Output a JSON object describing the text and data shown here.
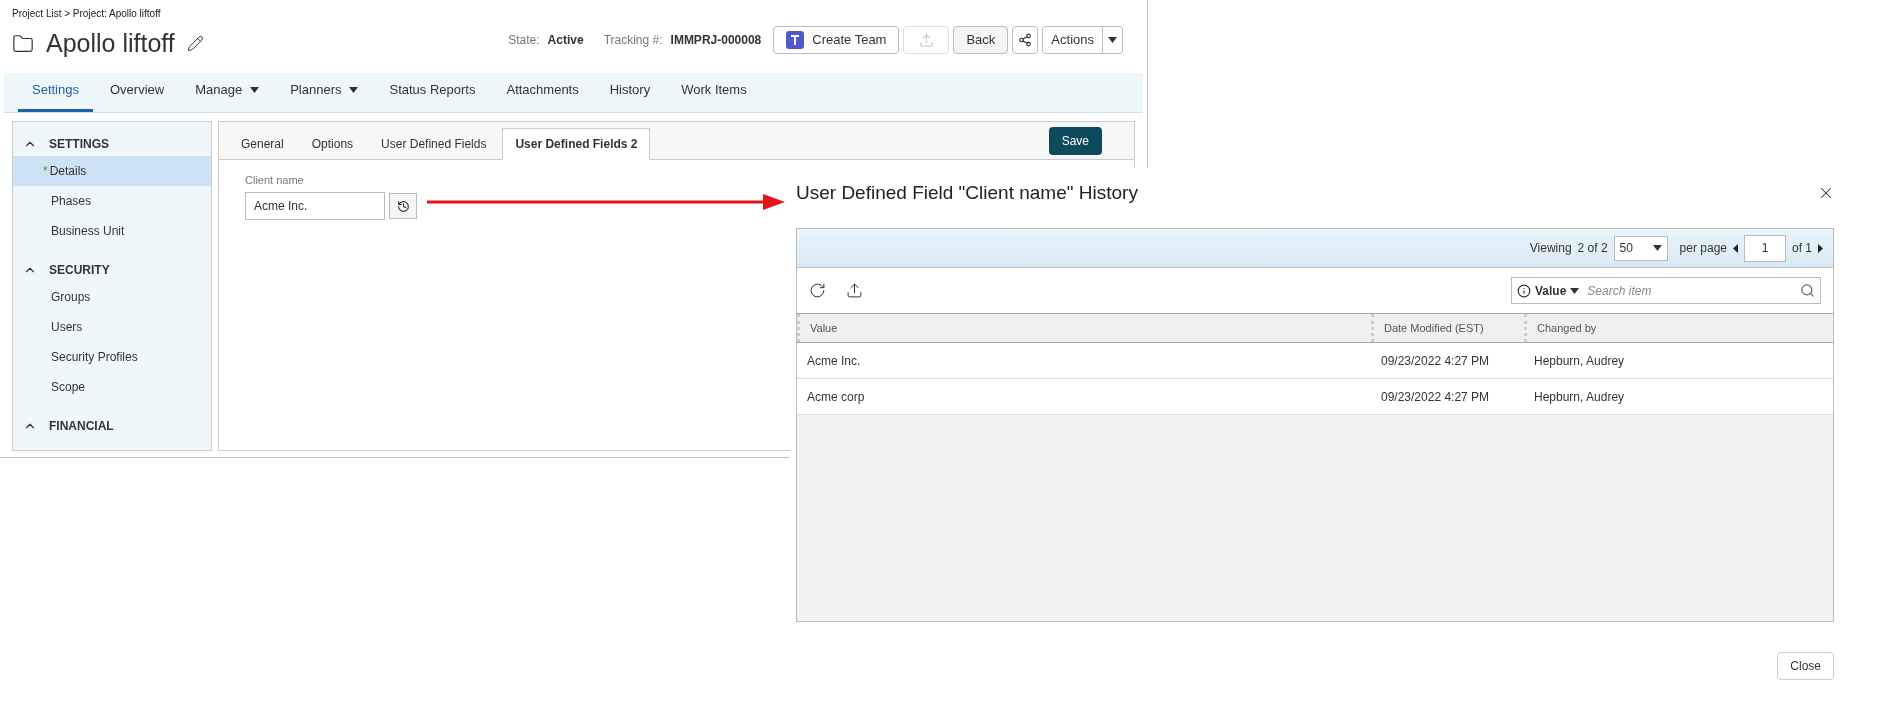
{
  "breadcrumb": "Project List > Project: Apollo liftoff",
  "header": {
    "title": "Apollo liftoff",
    "state_label": "State:",
    "state_value": "Active",
    "tracking_label": "Tracking #:",
    "tracking_value": "IMMPRJ-000008",
    "create_team": "Create Team",
    "export_disabled": true,
    "back": "Back",
    "actions": "Actions"
  },
  "nav_tabs": [
    {
      "label": "Settings",
      "selected": true,
      "dropdown": false
    },
    {
      "label": "Overview",
      "selected": false,
      "dropdown": false
    },
    {
      "label": "Manage",
      "selected": false,
      "dropdown": true
    },
    {
      "label": "Planners",
      "selected": false,
      "dropdown": true
    },
    {
      "label": "Status Reports",
      "selected": false,
      "dropdown": false
    },
    {
      "label": "Attachments",
      "selected": false,
      "dropdown": false
    },
    {
      "label": "History",
      "selected": false,
      "dropdown": false
    },
    {
      "label": "Work Items",
      "selected": false,
      "dropdown": false
    }
  ],
  "sidebar": [
    {
      "title": "SETTINGS",
      "expanded": true,
      "items": [
        {
          "label": "Details",
          "selected": true,
          "marker": "*"
        },
        {
          "label": "Phases",
          "selected": false
        },
        {
          "label": "Business Unit",
          "selected": false
        }
      ]
    },
    {
      "title": "SECURITY",
      "expanded": true,
      "items": [
        {
          "label": "Groups",
          "selected": false
        },
        {
          "label": "Users",
          "selected": false
        },
        {
          "label": "Security Profiles",
          "selected": false
        },
        {
          "label": "Scope",
          "selected": false
        }
      ]
    },
    {
      "title": "FINANCIAL",
      "expanded": true
    }
  ],
  "content_tabs": [
    {
      "label": "General",
      "selected": false
    },
    {
      "label": "Options",
      "selected": false
    },
    {
      "label": "User Defined Fields",
      "selected": false
    },
    {
      "label": "User Defined Fields 2",
      "selected": true
    }
  ],
  "save": "Save",
  "field": {
    "label": "Client name",
    "value": "Acme Inc."
  },
  "dialog": {
    "title": "User Defined Field \"Client name\" History",
    "pager": {
      "viewing": "Viewing",
      "count": "2 of 2",
      "per_page_value": "50",
      "per_page_label": "per page",
      "page": "1",
      "of": "of 1"
    },
    "search": {
      "filter": "Value",
      "placeholder": "Search item"
    },
    "columns": [
      "Value",
      "Date Modified (EST)",
      "Changed by"
    ],
    "rows": [
      [
        "Acme Inc.",
        "09/23/2022 4:27 PM",
        "Hepburn, Audrey"
      ],
      [
        "Acme corp",
        "09/23/2022 4:27 PM",
        "Hepburn, Audrey"
      ]
    ],
    "close": "Close"
  }
}
